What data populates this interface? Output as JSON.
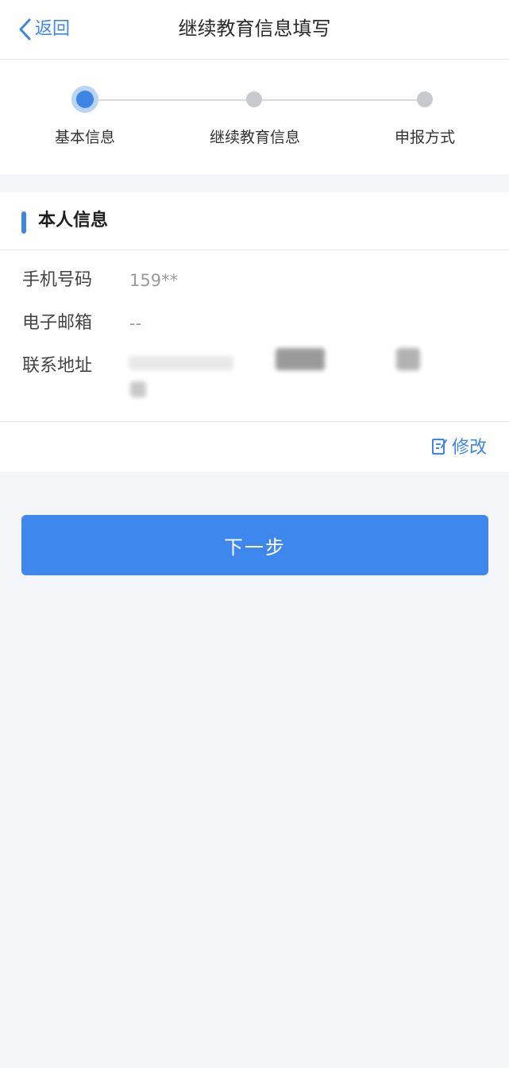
{
  "nav": {
    "back_label": "返回",
    "title": "继续教育信息填写"
  },
  "steps": [
    {
      "label": "基本信息",
      "state": "active"
    },
    {
      "label": "继续教育信息",
      "state": "inactive"
    },
    {
      "label": "申报方式",
      "state": "inactive"
    }
  ],
  "section": {
    "title": "本人信息",
    "fields": {
      "phone": {
        "label": "手机号码",
        "value": "159**"
      },
      "email": {
        "label": "电子邮箱",
        "value": "--"
      },
      "address": {
        "label": "联系地址",
        "value_state": "redacted"
      }
    },
    "edit_label": "修改"
  },
  "actions": {
    "next_label": "下一步"
  },
  "colors": {
    "accent": "#3d86e6",
    "background": "#f3f5f9",
    "inactive_dot": "#c8c9cc"
  },
  "icons": {
    "back": "chevron-left-icon",
    "edit": "edit-icon"
  }
}
